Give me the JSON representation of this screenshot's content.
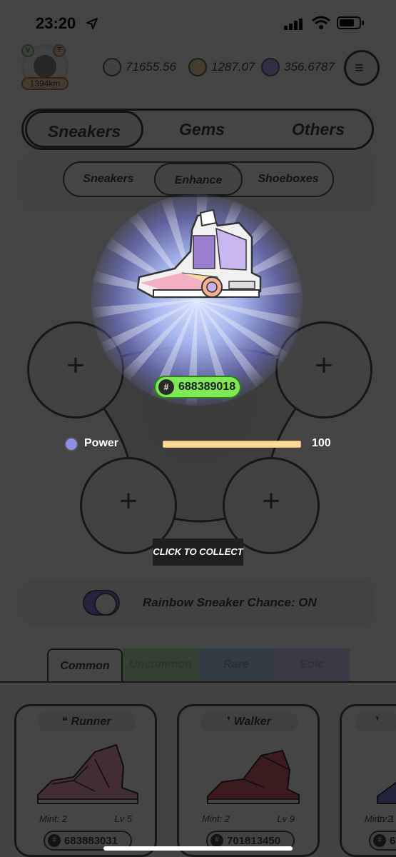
{
  "status_bar": {
    "time": "23:20"
  },
  "profile": {
    "badge_v": "V",
    "badge_t": "T",
    "distance": "1394km"
  },
  "currencies": [
    {
      "name": "gst-icon",
      "value": "71655.56"
    },
    {
      "name": "gmt-icon",
      "value": "1287.07"
    },
    {
      "name": "sol-icon",
      "value": "356.6787"
    }
  ],
  "main_tabs": [
    "Sneakers",
    "Gems",
    "Others"
  ],
  "sub_tabs": [
    "Sneakers",
    "Enhance",
    "Shoeboxes"
  ],
  "result": {
    "sneaker_id": "688389018",
    "power_label": "Power",
    "power_value": "100",
    "power_fraction": 1.0,
    "collect_label": "CLICK TO COLLECT"
  },
  "slots": {
    "plus": "+"
  },
  "rainbow": {
    "label": "Rainbow Sneaker Chance: ON"
  },
  "rarity_tabs": [
    "Common",
    "Uncommon",
    "Rare",
    "Epic"
  ],
  "cards": [
    {
      "type": "Runner",
      "mint": "Mint: 2",
      "level": "Lv 5",
      "id": "683883031"
    },
    {
      "type": "Walker",
      "mint": "Mint: 2",
      "level": "Lv 9",
      "id": "701813450"
    },
    {
      "type": "",
      "mint": "Mint: 2",
      "level": "Lv 1",
      "id": "6"
    }
  ],
  "colors": {
    "id_pill": "#7fe857",
    "power_bar": "#ffd79a",
    "toggle": "#8b7be8"
  }
}
